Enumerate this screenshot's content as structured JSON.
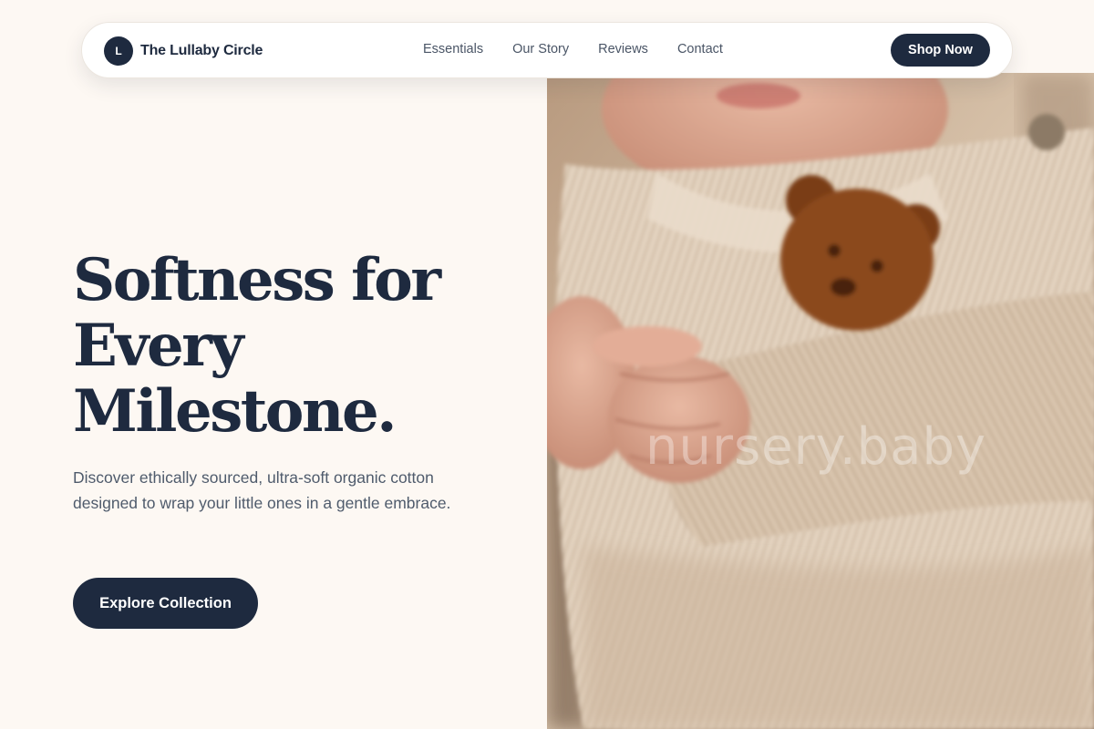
{
  "brand": {
    "logo_letter": "L",
    "name": "The Lullaby Circle"
  },
  "nav": {
    "links": [
      "Essentials",
      "Our Story",
      "Reviews",
      "Contact"
    ],
    "cta_label": "Shop Now"
  },
  "hero": {
    "title_lines": [
      "Softness for",
      "Every",
      "Milestone."
    ],
    "description": "Discover ethically sourced, ultra-soft organic cotton designed to wrap your little ones in a gentle embrace.",
    "cta_label": "Explore Collection",
    "image_watermark": "nursery.baby"
  },
  "colors": {
    "background": "#fdf8f3",
    "navy": "#1e2a3f",
    "body_text": "#4f5b6c",
    "nav_text": "#4a5566"
  }
}
